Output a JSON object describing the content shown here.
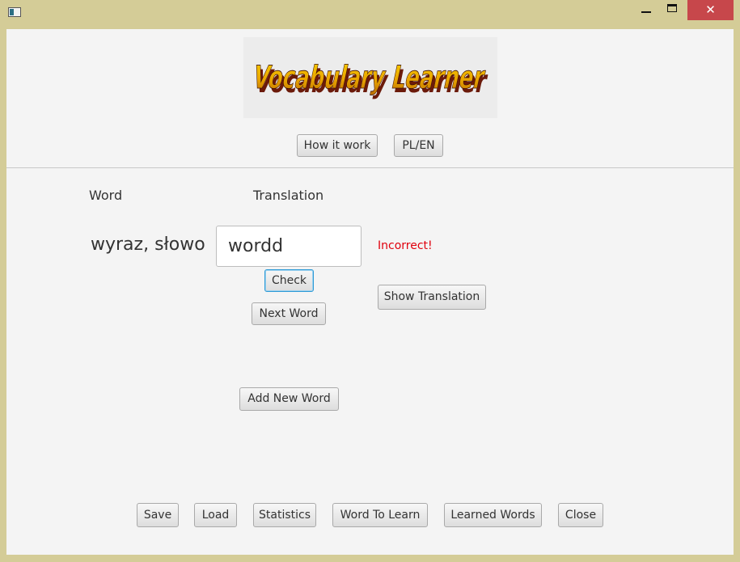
{
  "window": {
    "close_glyph": "✕"
  },
  "header": {
    "logo_text": "Vocabulary Learner",
    "how_it_work_label": "How it work",
    "language_toggle_label": "PL/EN"
  },
  "quiz": {
    "word_header": "Word",
    "translation_header": "Translation",
    "current_word": "wyraz, słowo",
    "answer_value": "wordd",
    "result_text": "Incorrect!",
    "check_label": "Check",
    "next_word_label": "Next Word",
    "show_translation_label": "Show Translation",
    "add_new_word_label": "Add New Word"
  },
  "footer": {
    "buttons": [
      "Save",
      "Load",
      "Statistics",
      "Word To Learn",
      "Learned Words",
      "Close"
    ]
  },
  "colors": {
    "window_frame": "#d4cc97",
    "client_background": "#f4f4f4",
    "close_button": "#c7474b",
    "error_text": "#e0000d",
    "logo_fill": "#f0b000",
    "logo_shadow": "#6b1a0a",
    "focus_ring": "#2d9ad6"
  }
}
